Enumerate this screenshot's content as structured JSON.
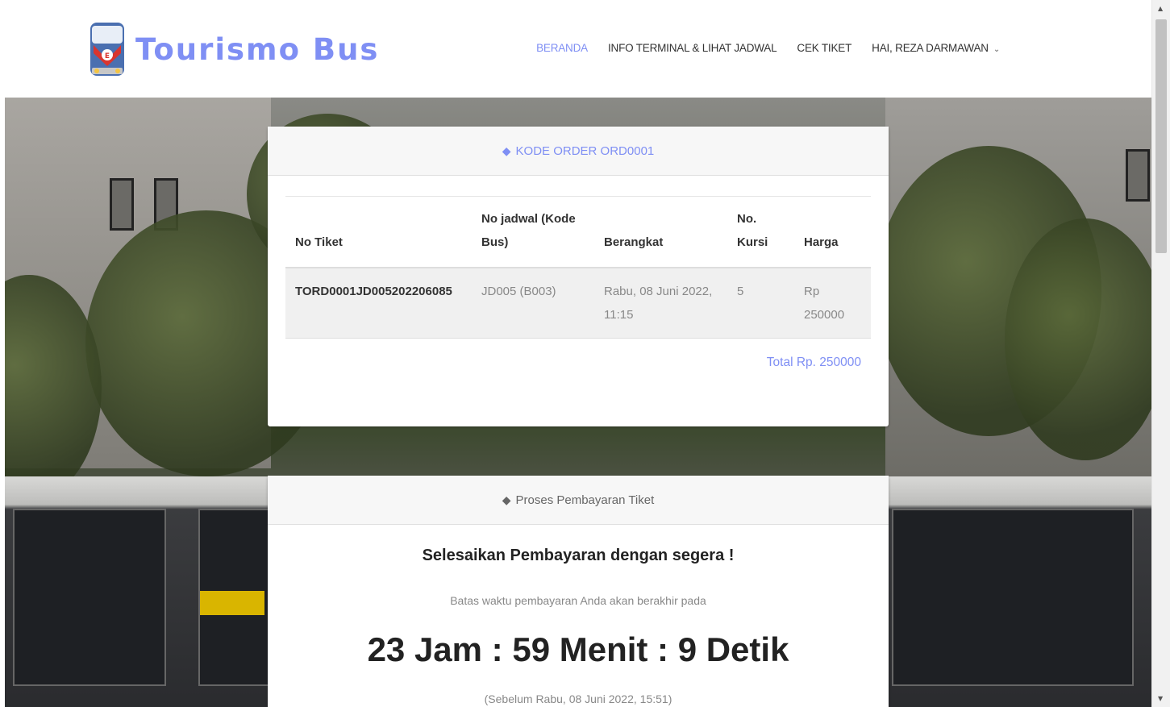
{
  "brand": {
    "name": "Tourismo Bus",
    "accent": "#7f8ff4"
  },
  "nav": {
    "items": [
      {
        "label": "BERANDA",
        "active": true
      },
      {
        "label": "INFO TERMINAL & LIHAT JADWAL",
        "active": false
      },
      {
        "label": "CEK TIKET",
        "active": false
      },
      {
        "label": "HAI, REZA DARMAWAN",
        "active": false
      }
    ]
  },
  "order": {
    "header": "KODE ORDER ORD0001",
    "columns": [
      "No Tiket",
      "No jadwal (Kode Bus)",
      "Berangkat",
      "No. Kursi",
      "Harga"
    ],
    "rows": [
      {
        "ticket": "TORD0001JD005202206085",
        "schedule": "JD005 (B003)",
        "departure": "Rabu, 08 Juni 2022, 11:15",
        "seat": "5",
        "price": "Rp 250000"
      }
    ],
    "total": "Total Rp. 250000"
  },
  "payment": {
    "header": "Proses Pembayaran Tiket",
    "title": "Selesaikan Pembayaran dengan segera !",
    "subtitle": "Batas waktu pembayaran Anda akan berakhir pada",
    "countdown": "23 Jam : 59 Menit : 9 Detik",
    "deadline": "(Sebelum Rabu, 08 Juni 2022, 15:51)"
  },
  "icons": {
    "tag": "tag-icon",
    "chevron": "chevron-down-icon"
  }
}
